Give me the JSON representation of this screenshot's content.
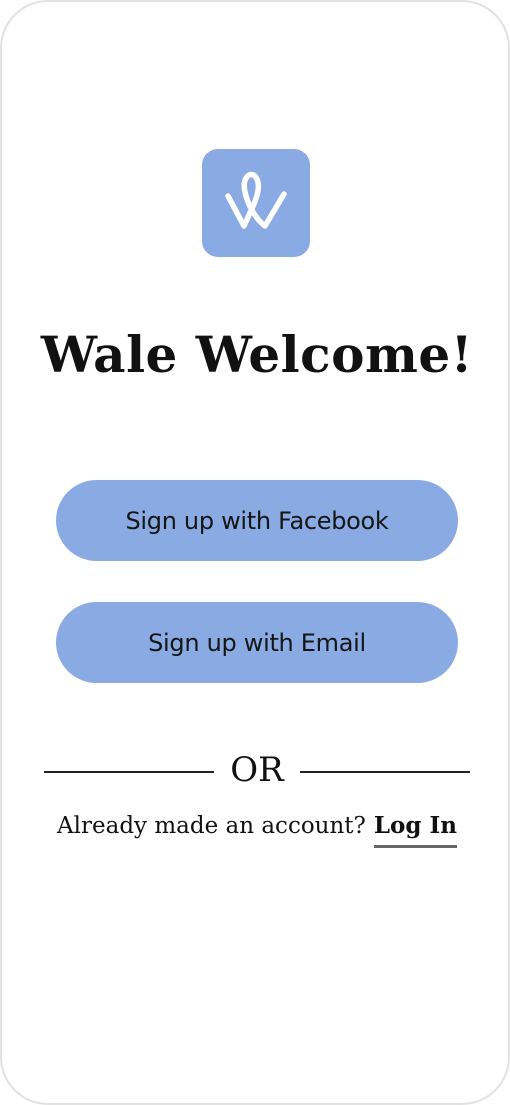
{
  "colors": {
    "accent": "#8aaae3",
    "logo_mark": "#ffffff",
    "text": "#111111",
    "frame_border": "#e2e2e2"
  },
  "app": {
    "logo_icon": "w-logo-icon",
    "title": "Wale Welcome!"
  },
  "actions": {
    "facebook_label": "Sign up with Facebook",
    "email_label": "Sign up with Email"
  },
  "divider": {
    "label": "OR"
  },
  "login": {
    "prompt": "Already made an account?",
    "link_label": "Log In"
  }
}
